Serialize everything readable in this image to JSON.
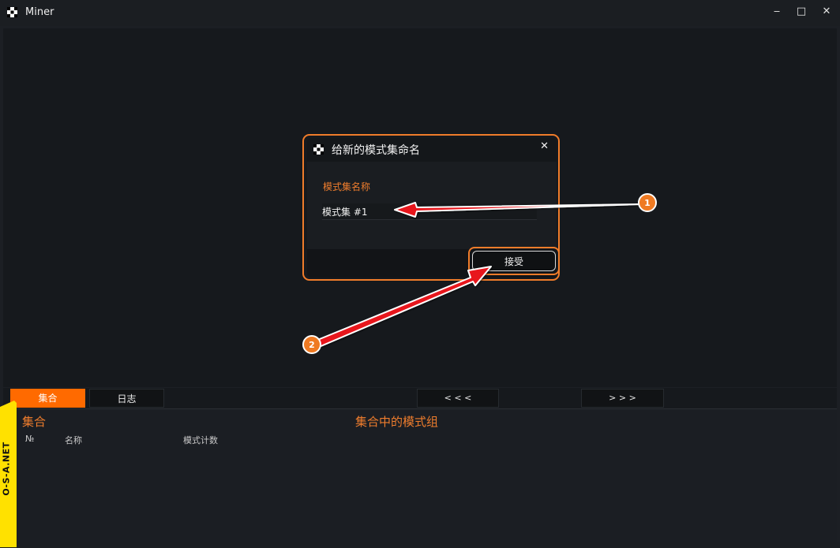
{
  "window": {
    "title": "Miner",
    "minimize": "‒",
    "maximize": "□",
    "close": "✕"
  },
  "dialog": {
    "title": "给新的模式集命名",
    "close": "✕",
    "field_label": "模式集名称",
    "input_value": "模式集 #1",
    "accept_label": "接受"
  },
  "tabs": [
    {
      "label": "集合",
      "active": true
    },
    {
      "label": "日志",
      "active": false
    }
  ],
  "nav": {
    "prev": "< < <",
    "next": "> > >"
  },
  "panel": {
    "left_title": "集合",
    "center_title": "集合中的模式组",
    "columns": [
      "№",
      "名称",
      "模式计数"
    ]
  },
  "annotations": {
    "badge_1": "1",
    "badge_2": "2"
  },
  "watermark": "O-S-A.NET",
  "colors": {
    "accent": "#ff6a00",
    "arrow": "#e8141c",
    "watermark_bg": "#ffe100"
  }
}
